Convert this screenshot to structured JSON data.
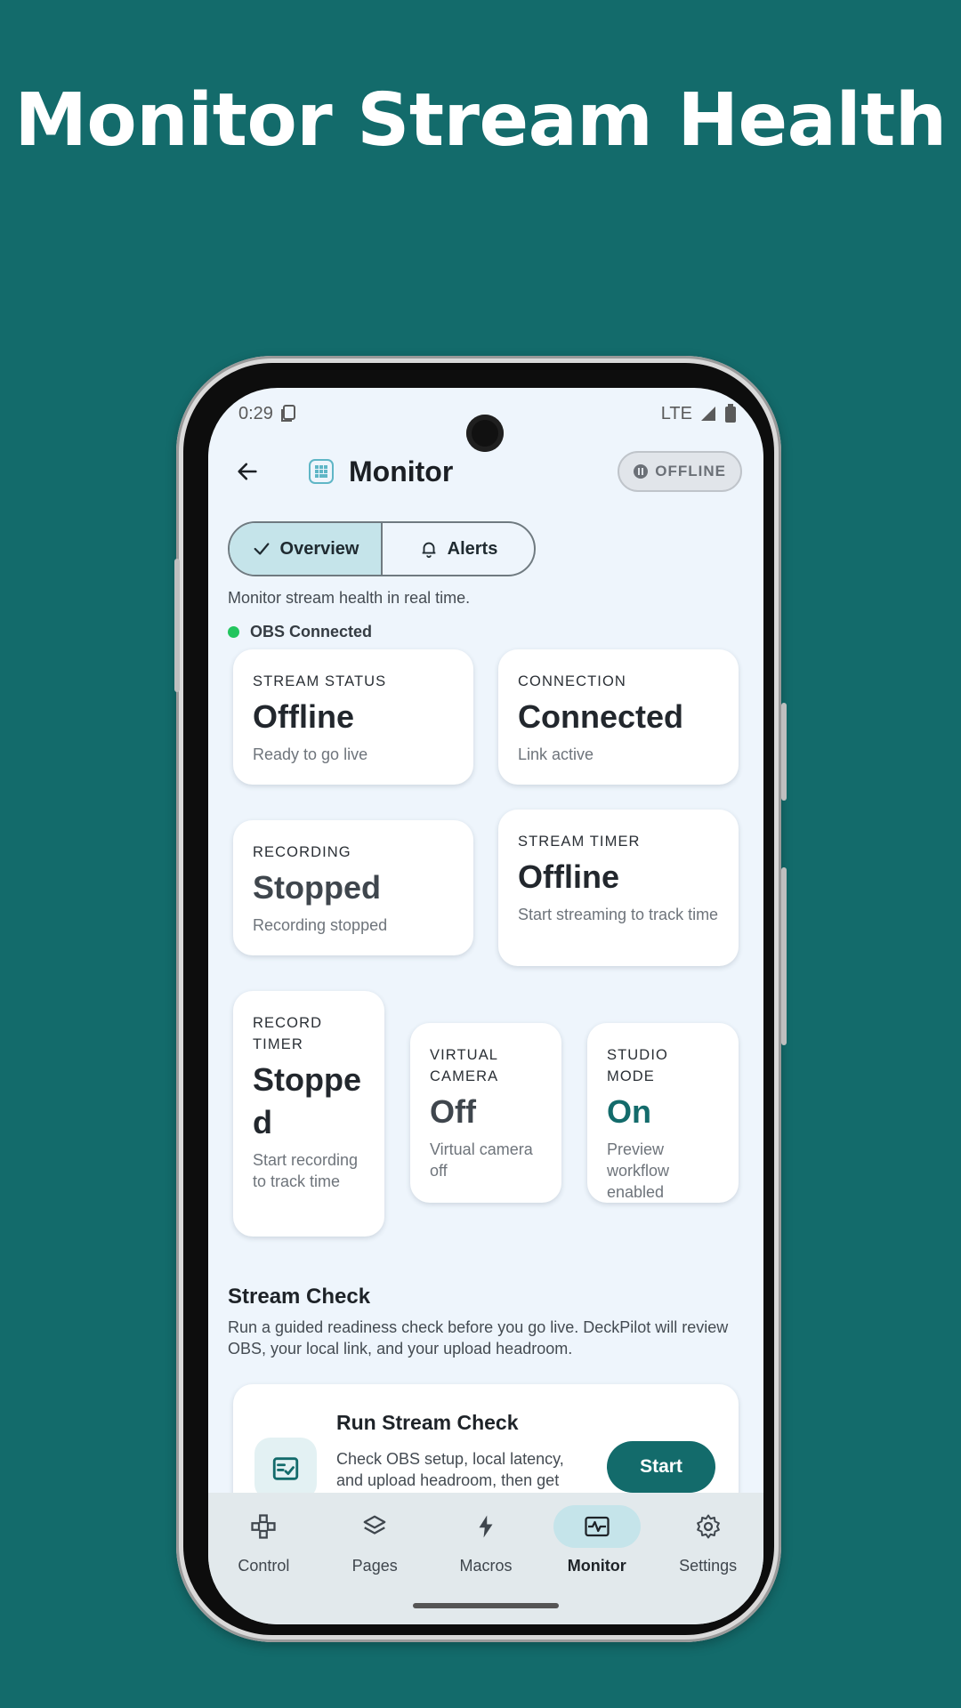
{
  "headline": "Monitor Stream Health",
  "status_bar": {
    "time": "0:29",
    "network": "LTE"
  },
  "app_bar": {
    "title": "Monitor",
    "status_chip": "OFFLINE"
  },
  "tabs": [
    {
      "label": "Overview",
      "active": true
    },
    {
      "label": "Alerts",
      "active": false
    }
  ],
  "subtitle": "Monitor stream health in real time.",
  "connection_indicator": "OBS Connected",
  "cards": {
    "stream_status": {
      "key": "STREAM STATUS",
      "value": "Offline",
      "sub": "Ready to go live"
    },
    "connection": {
      "key": "CONNECTION",
      "value": "Connected",
      "sub": "Link active"
    },
    "recording": {
      "key": "RECORDING",
      "value": "Stopped",
      "sub": "Recording stopped"
    },
    "stream_timer": {
      "key": "STREAM TIMER",
      "value": "Offline",
      "sub": "Start streaming to track time"
    },
    "record_timer": {
      "key": "RECORD TIMER",
      "value": "Stopped",
      "sub": "Start recording to track time"
    },
    "virtual_camera": {
      "key": "VIRTUAL CAMERA",
      "value": "Off",
      "sub": "Virtual camera off"
    },
    "studio_mode": {
      "key": "STUDIO MODE",
      "value": "On",
      "sub": "Preview workflow enabled"
    }
  },
  "stream_check": {
    "title": "Stream Check",
    "description": "Run a guided readiness check before you go live. DeckPilot will review OBS, your local link, and your upload headroom.",
    "card_title": "Run Stream Check",
    "card_desc": "Check OBS setup, local latency, and upload headroom, then get",
    "button": "Start"
  },
  "bottom_nav": [
    {
      "label": "Control",
      "icon": "gamepad-icon"
    },
    {
      "label": "Pages",
      "icon": "layers-icon"
    },
    {
      "label": "Macros",
      "icon": "bolt-icon"
    },
    {
      "label": "Monitor",
      "icon": "monitor-pulse-icon",
      "active": true
    },
    {
      "label": "Settings",
      "icon": "gear-icon"
    }
  ],
  "colors": {
    "background": "#136b6b",
    "accent": "#136b6b",
    "active_pill": "#c5e4ea",
    "connected_dot": "#22c55e"
  }
}
